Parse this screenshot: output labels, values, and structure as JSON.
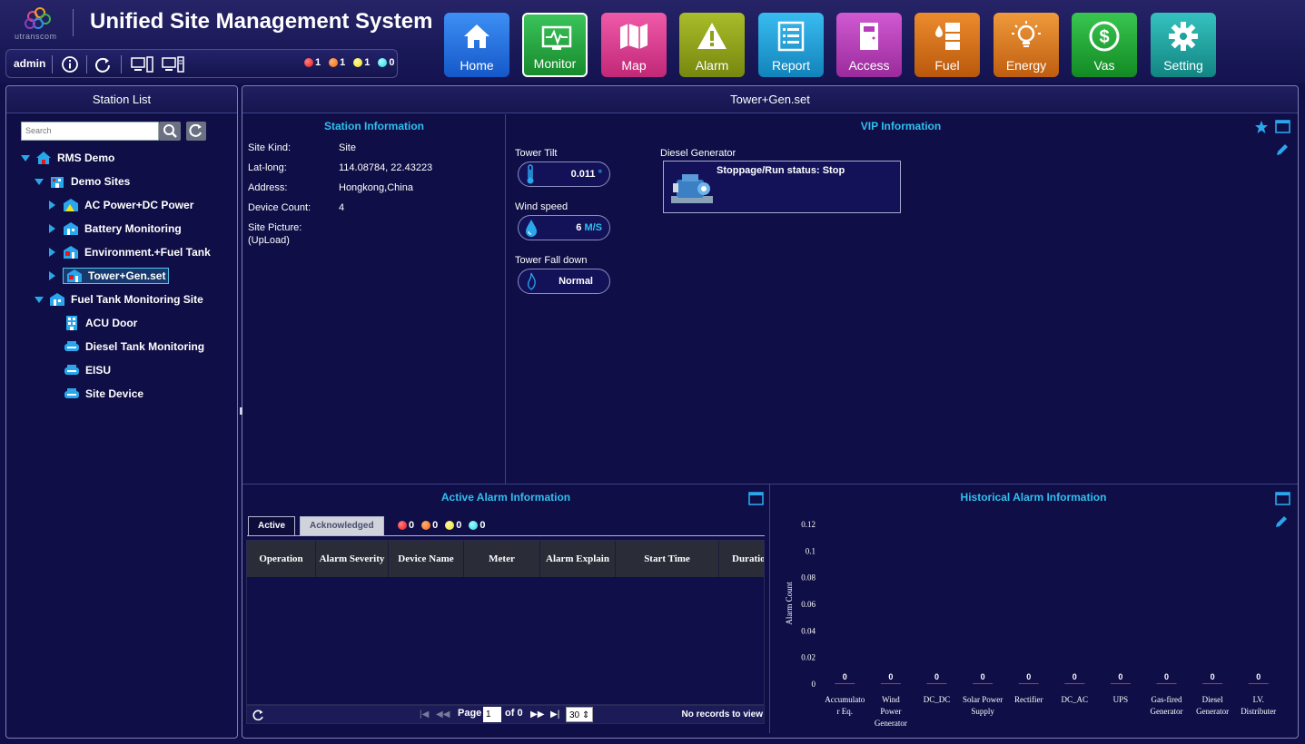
{
  "header": {
    "logo_text": "utranscom",
    "app_title": "Unified Site Management System"
  },
  "userbar": {
    "username": "admin",
    "alarm_counts": [
      {
        "color": "#e8151a",
        "count": "1"
      },
      {
        "color": "#f06a10",
        "count": "1"
      },
      {
        "color": "#f1e11d",
        "count": "1"
      },
      {
        "color": "#2ad4e0",
        "count": "0"
      }
    ]
  },
  "nav": [
    {
      "label": "Home",
      "color": "#1d6fe0",
      "icon": "home-icon"
    },
    {
      "label": "Monitor",
      "color": "#1da83b",
      "icon": "monitor-icon"
    },
    {
      "label": "Map",
      "color": "#d83a8e",
      "icon": "map-icon"
    },
    {
      "label": "Alarm",
      "color": "#8fa019",
      "icon": "alarm-icon"
    },
    {
      "label": "Report",
      "color": "#1aa2d8",
      "icon": "report-icon"
    },
    {
      "label": "Access",
      "color": "#b73bb8",
      "icon": "access-icon"
    },
    {
      "label": "Fuel",
      "color": "#d7741a",
      "icon": "fuel-icon"
    },
    {
      "label": "Energy",
      "color": "#d87b20",
      "icon": "energy-icon"
    },
    {
      "label": "Vas",
      "color": "#1fa534",
      "icon": "vas-icon"
    },
    {
      "label": "Setting",
      "color": "#1aa3a0",
      "icon": "setting-icon"
    }
  ],
  "station_list": {
    "title": "Station List",
    "search_placeholder": "Search",
    "tree": [
      {
        "label": "RMS Demo",
        "expander": "down",
        "icon": "home-icon"
      },
      {
        "label": "Demo Sites",
        "expander": "down",
        "icon": "building-icon"
      },
      {
        "label": "AC Power+DC Power",
        "expander": "right",
        "icon": "site-warning-icon"
      },
      {
        "label": "Battery Monitoring",
        "expander": "right",
        "icon": "site-icon"
      },
      {
        "label": "Environment.+Fuel Tank",
        "expander": "right",
        "icon": "site-alarm-icon"
      },
      {
        "label": "Tower+Gen.set",
        "expander": "right",
        "icon": "site-alarm-icon",
        "selected": true
      },
      {
        "label": "Fuel Tank Monitoring Site",
        "expander": "down",
        "icon": "site-icon"
      },
      {
        "label": "ACU Door",
        "expander": "",
        "icon": "door-icon"
      },
      {
        "label": "Diesel Tank Monitoring",
        "expander": "",
        "icon": "tank-icon"
      },
      {
        "label": "EISU",
        "expander": "",
        "icon": "tank-icon"
      },
      {
        "label": "Site Device",
        "expander": "",
        "icon": "tank-icon"
      }
    ]
  },
  "main": {
    "title": "Tower+Gen.set",
    "station_info": {
      "title": "Station Information",
      "rows": [
        {
          "label": "Site Kind:",
          "value": "Site"
        },
        {
          "label": "Lat-long:",
          "value": "114.08784, 22.43223"
        },
        {
          "label": "Address:",
          "value": "Hongkong,China"
        },
        {
          "label": "Device Count:",
          "value": "4"
        }
      ],
      "picture_label": "Site Picture:",
      "picture_action": "(UpLoad)"
    },
    "vip_info": {
      "title": "VIP Information",
      "gauges": [
        {
          "label": "Tower Tilt",
          "value": "0.011",
          "unit": "°",
          "icon": "thermometer-icon"
        },
        {
          "label": "Wind speed",
          "value": "6",
          "unit": "M/S",
          "icon": "water-drop-icon"
        },
        {
          "label": "Tower Fall down",
          "value": "Normal",
          "unit": "",
          "icon": "flame-icon"
        }
      ],
      "generator": {
        "label": "Diesel Generator",
        "status": "Stoppage/Run status: Stop"
      }
    },
    "active_alarm": {
      "title": "Active Alarm Information",
      "tabs": [
        "Active",
        "Acknowledged"
      ],
      "counts": [
        {
          "color": "#e8151a",
          "count": "0"
        },
        {
          "color": "#f06a10",
          "count": "0"
        },
        {
          "color": "#f1e11d",
          "count": "0"
        },
        {
          "color": "#2ad4e0",
          "count": "0"
        }
      ],
      "columns": [
        "Operation",
        "Alarm Severity",
        "Device Name",
        "Meter",
        "Alarm Explain",
        "Start Time",
        "Duratio"
      ],
      "pager": {
        "page_label": "Page",
        "page_value": "1",
        "of_label": "of 0",
        "page_size": "30",
        "status": "No records to view"
      }
    },
    "historical_alarm": {
      "title": "Historical Alarm Information"
    }
  },
  "chart_data": {
    "type": "bar",
    "title": "",
    "xlabel": "",
    "ylabel": "Alarm Count",
    "ylim": [
      0,
      0.12
    ],
    "yticks": [
      "0.12",
      "0.1",
      "0.08",
      "0.06",
      "0.04",
      "0.02",
      "0"
    ],
    "categories": [
      "Accumulator Eq.",
      "Wind Power Generator",
      "DC_DC",
      "Solar Power Supply",
      "Rectifier",
      "DC_AC",
      "UPS",
      "Gas-fired Generator",
      "Diesel Generator",
      "LV. Distributer"
    ],
    "category_lines": [
      [
        "Accumulato",
        "r Eq."
      ],
      [
        "Wind",
        "Power",
        "Generator"
      ],
      [
        "DC_DC"
      ],
      [
        "Solar Power",
        "Supply"
      ],
      [
        "Rectifier"
      ],
      [
        "DC_AC"
      ],
      [
        "UPS"
      ],
      [
        "Gas-fired",
        "Generator"
      ],
      [
        "Diesel",
        "Generator"
      ],
      [
        "LV.",
        "Distributer"
      ]
    ],
    "values": [
      0,
      0,
      0,
      0,
      0,
      0,
      0,
      0,
      0,
      0
    ],
    "data_labels": [
      "0",
      "0",
      "0",
      "0",
      "0",
      "0",
      "0",
      "0",
      "0",
      "0"
    ],
    "bar_color": "#c0392b",
    "grid": false
  }
}
